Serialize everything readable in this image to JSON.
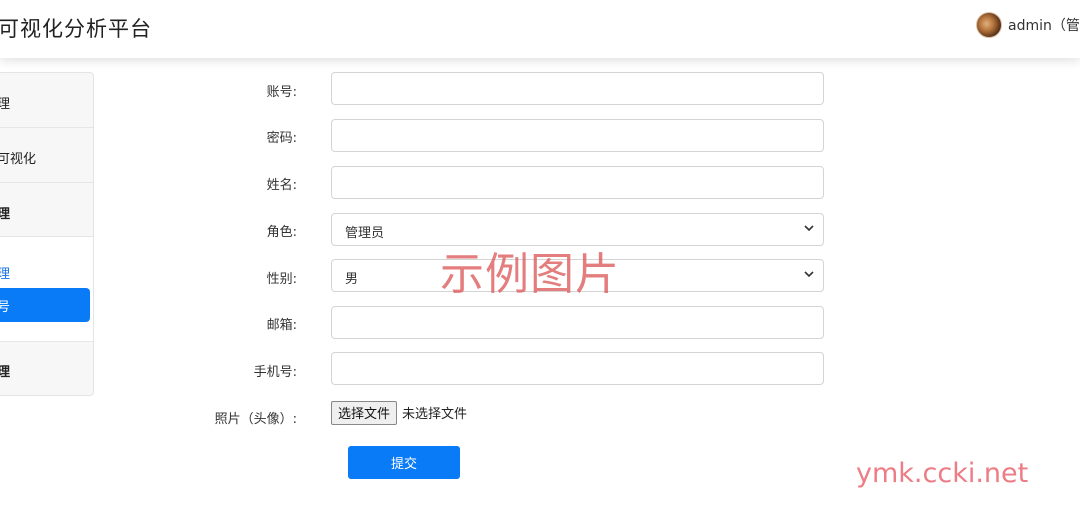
{
  "header": {
    "title": "可视化分析平台",
    "user": "admin（管理"
  },
  "sidebar": {
    "items": [
      {
        "label": "理"
      },
      {
        "label": "可视化"
      },
      {
        "label": "理"
      },
      {
        "label": "理"
      }
    ],
    "submenu": {
      "link": "理",
      "active": "号"
    }
  },
  "form": {
    "account_label": "账号:",
    "password_label": "密码:",
    "name_label": "姓名:",
    "role_label": "角色:",
    "role_value": "管理员",
    "gender_label": "性别:",
    "gender_value": "男",
    "email_label": "邮箱:",
    "phone_label": "手机号:",
    "photo_label": "照片（头像）:",
    "file_button": "选择文件",
    "file_status": "未选择文件",
    "submit": "提交"
  },
  "watermarks": {
    "center": "示例图片",
    "site": "ymk.ccki.net"
  },
  "colors": {
    "primary": "#0a7bf6",
    "link": "#1473e6"
  }
}
